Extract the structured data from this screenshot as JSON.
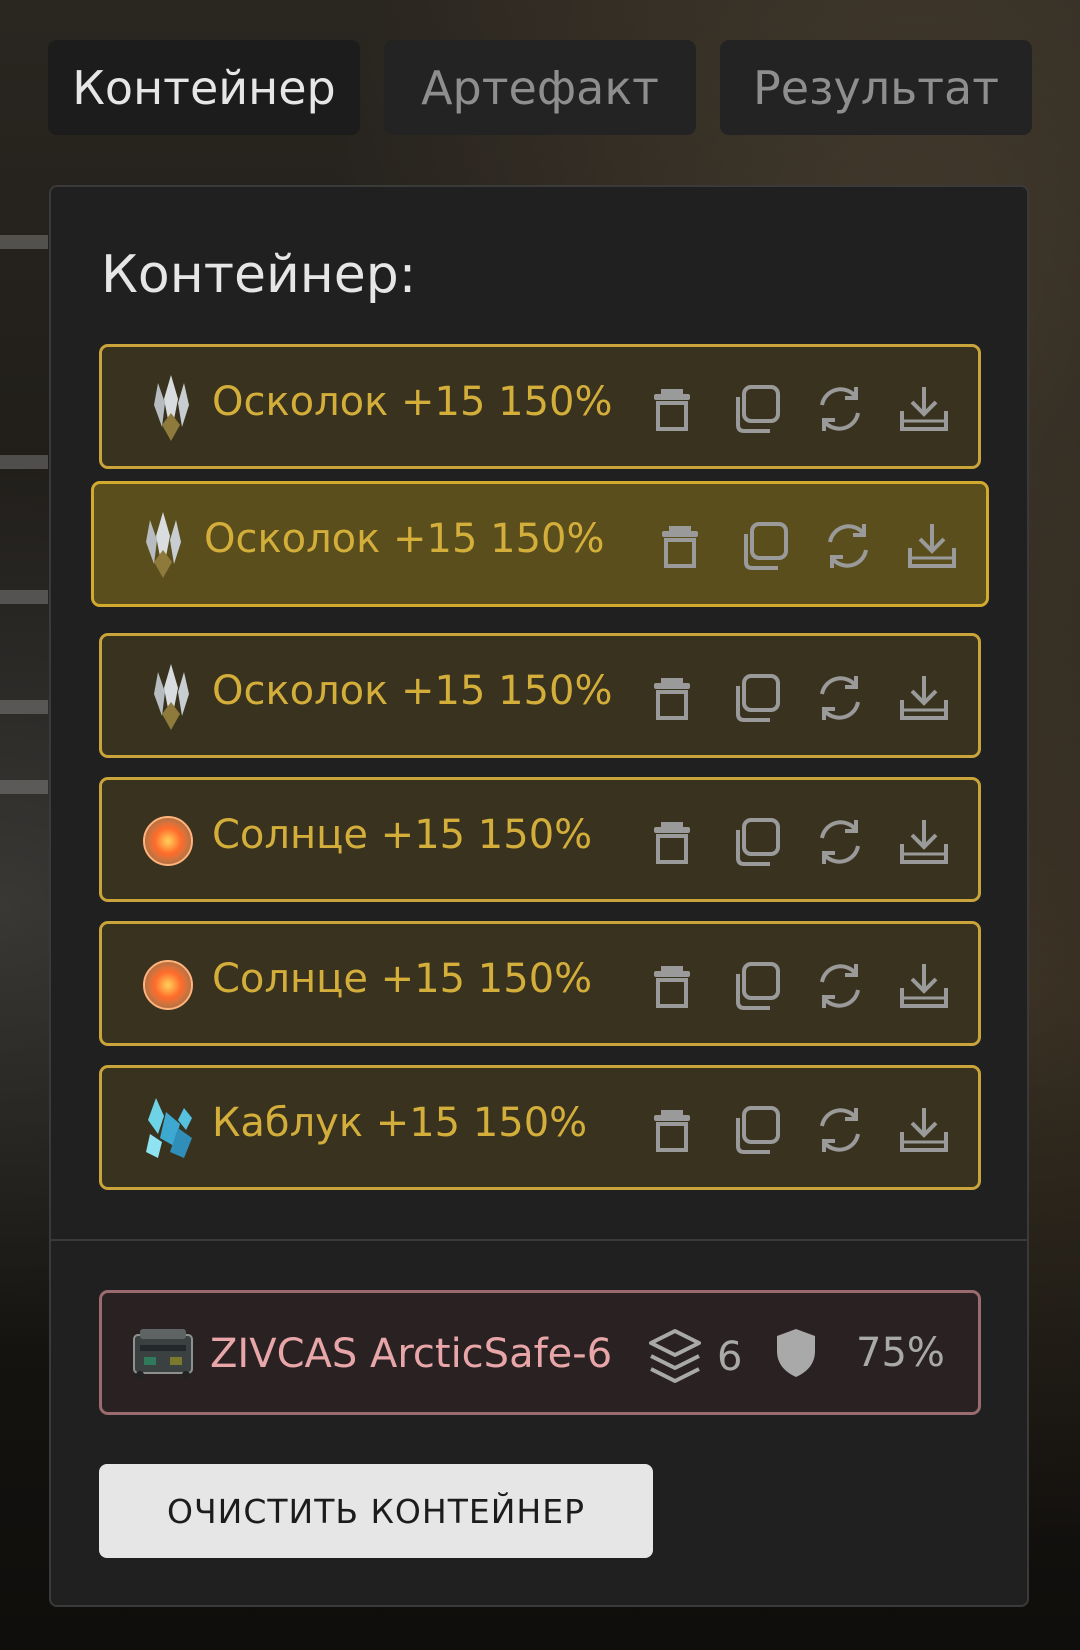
{
  "tabs": [
    {
      "label": "Контейнер",
      "active": true
    },
    {
      "label": "Артефакт",
      "active": false
    },
    {
      "label": "Результат",
      "active": false
    }
  ],
  "panel": {
    "title": "Контейнер:",
    "items": [
      {
        "label": "Осколок +15 150%",
        "icon": "shard-crystal-icon",
        "selected": false
      },
      {
        "label": "Осколок +15 150%",
        "icon": "shard-crystal-icon",
        "selected": true
      },
      {
        "label": "Осколок +15 150%",
        "icon": "shard-crystal-icon",
        "selected": false
      },
      {
        "label": "Солнце +15 150%",
        "icon": "sun-orb-icon",
        "selected": false
      },
      {
        "label": "Солнце +15 150%",
        "icon": "sun-orb-icon",
        "selected": false
      },
      {
        "label": "Каблук +15 150%",
        "icon": "heel-crystal-icon",
        "selected": false
      }
    ],
    "item_actions": [
      "trash-icon",
      "copy-icon",
      "refresh-icon",
      "download-icon"
    ]
  },
  "container": {
    "name": "ZIVCAS ArcticSafe-6",
    "slots": "6",
    "protection": "75%"
  },
  "clear_button": "ОЧИСТИТЬ КОНТЕЙНЕР",
  "colors": {
    "item_border": "#c9a43a",
    "item_text": "#d4ae3a",
    "container_border": "#9a6b6f",
    "container_text": "#e9a6a9"
  }
}
